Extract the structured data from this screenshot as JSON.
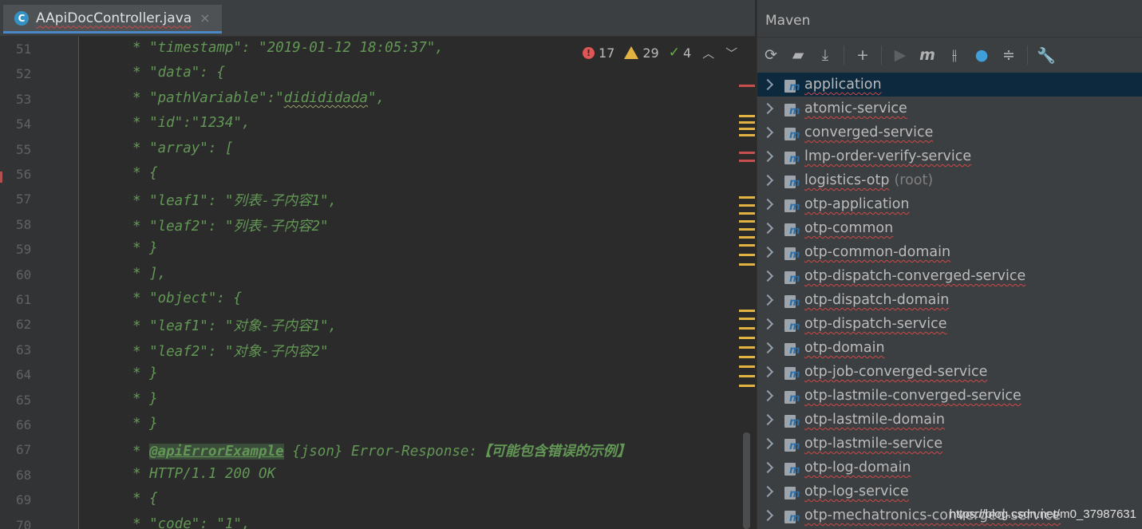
{
  "editor": {
    "tab": {
      "filename": "AApiDocController.java",
      "icon_letter": "C",
      "close_symbol": "×"
    },
    "inspections": {
      "errors": "17",
      "warnings": "29",
      "weak_warnings": "4"
    },
    "lines": [
      {
        "n": "51",
        "text": "* \"timestamp\": \"2019-01-12 18:05:37\","
      },
      {
        "n": "52",
        "text": "* \"data\": {"
      },
      {
        "n": "53",
        "text_pre": "* \"pathVariable\":\"",
        "text_squig": "didididada",
        "text_post": "\","
      },
      {
        "n": "54",
        "text": "* \"id\":\"1234\","
      },
      {
        "n": "55",
        "text": "* \"array\": ["
      },
      {
        "n": "56",
        "text": "* {"
      },
      {
        "n": "57",
        "text": "* \"leaf1\": \"列表-子内容1\","
      },
      {
        "n": "58",
        "text": "* \"leaf2\": \"列表-子内容2\""
      },
      {
        "n": "59",
        "text": "* }"
      },
      {
        "n": "60",
        "text": "* ],"
      },
      {
        "n": "61",
        "text": "* \"object\": {"
      },
      {
        "n": "62",
        "text": "* \"leaf1\": \"对象-子内容1\","
      },
      {
        "n": "63",
        "text": "* \"leaf2\": \"对象-子内容2\""
      },
      {
        "n": "64",
        "text": "* }"
      },
      {
        "n": "65",
        "text": "* }"
      },
      {
        "n": "66",
        "text": "* }"
      },
      {
        "n": "67",
        "text_pre": "* ",
        "tag": "@apiErrorExample",
        "text_post": " {json} Error-Response:",
        "text_bold": "【可能包含错误的示例】"
      },
      {
        "n": "68",
        "text": "* HTTP/1.1 200 OK"
      },
      {
        "n": "69",
        "text": "* {"
      },
      {
        "n": "70",
        "text": "* \"code\": \"1\","
      }
    ]
  },
  "maven": {
    "title": "Maven",
    "toolbar_icons": [
      "reload-icon",
      "add-sources-icon",
      "download-icon",
      "plus-icon",
      "run-icon",
      "maven-goal-icon",
      "toggle-offline-icon",
      "skip-tests-icon",
      "collapse-icon",
      "settings-icon"
    ],
    "projects": [
      {
        "label": "application",
        "selected": true
      },
      {
        "label": "atomic-service"
      },
      {
        "label": "converged-service"
      },
      {
        "label": "lmp-order-verify-service"
      },
      {
        "label": "logistics-otp",
        "suffix": "(root)"
      },
      {
        "label": "otp-application"
      },
      {
        "label": "otp-common"
      },
      {
        "label": "otp-common-domain"
      },
      {
        "label": "otp-dispatch-converged-service"
      },
      {
        "label": "otp-dispatch-domain"
      },
      {
        "label": "otp-dispatch-service"
      },
      {
        "label": "otp-domain"
      },
      {
        "label": "otp-job-converged-service"
      },
      {
        "label": "otp-lastmile-converged-service"
      },
      {
        "label": "otp-lastmile-domain"
      },
      {
        "label": "otp-lastmile-service"
      },
      {
        "label": "otp-log-domain"
      },
      {
        "label": "otp-log-service"
      },
      {
        "label": "otp-mechatronics-converged-service"
      }
    ]
  },
  "watermark": "https://blog.csdn.net/m0_37987631",
  "colors": {
    "comment": "#629755",
    "selection": "#0d293e",
    "error": "#e05555",
    "warning": "#e3b341"
  }
}
